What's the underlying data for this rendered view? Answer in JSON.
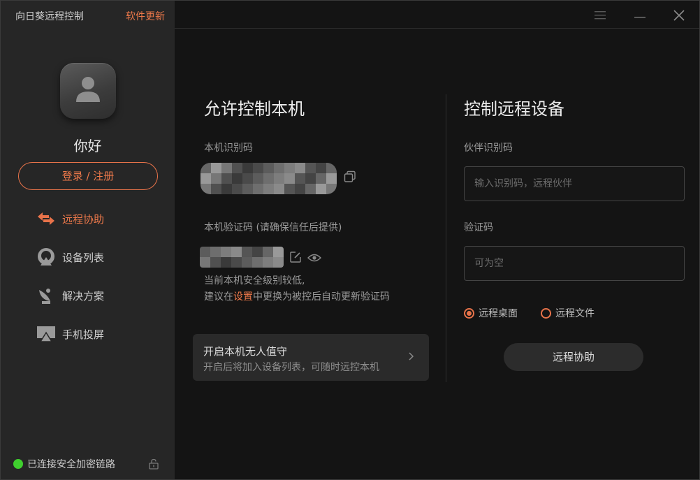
{
  "app": {
    "title": "向日葵远程控制",
    "update_label": "软件更新"
  },
  "user": {
    "greeting": "你好",
    "login_label": "登录 / 注册"
  },
  "nav": {
    "items": [
      {
        "label": "远程协助",
        "icon": "remote-assist-icon",
        "active": true
      },
      {
        "label": "设备列表",
        "icon": "device-list-icon",
        "active": false
      },
      {
        "label": "解决方案",
        "icon": "solution-icon",
        "active": false
      },
      {
        "label": "手机投屏",
        "icon": "screen-cast-icon",
        "active": false
      }
    ]
  },
  "status": {
    "text": "已连接安全加密链路"
  },
  "allow": {
    "title": "允许控制本机",
    "id_label": "本机识别码",
    "code_label": "本机验证码 (请确保信任后提供)",
    "warning_line1": "当前本机安全级别较低,",
    "warning_prefix": "建议在",
    "warning_link": "设置",
    "warning_suffix": "中更换为被控后自动更新验证码",
    "unattended_title": "开启本机无人值守",
    "unattended_desc": "开启后将加入设备列表，可随时远控本机"
  },
  "control": {
    "title": "控制远程设备",
    "partner_label": "伙伴识别码",
    "partner_placeholder": "输入识别码，远程伙伴",
    "code_label": "验证码",
    "code_placeholder": "可为空",
    "radio_desktop": "远程桌面",
    "radio_file": "远程文件",
    "selected_mode": "远程桌面",
    "button_label": "远程协助"
  },
  "colors": {
    "accent": "#f07a4b",
    "status_green": "#3fcf2e",
    "background": "#141414",
    "sidebar": "#262626"
  }
}
